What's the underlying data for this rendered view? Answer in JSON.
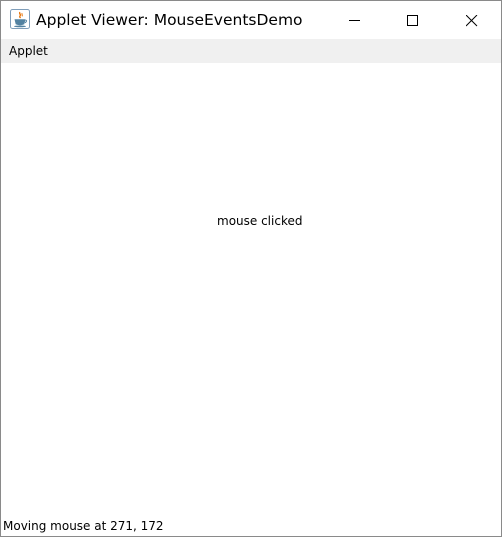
{
  "window": {
    "title": "Applet Viewer: MouseEventsDemo"
  },
  "title_controls": {
    "minimize_icon": "minimize-icon",
    "maximize_icon": "maximize-icon",
    "close_icon": "close-icon"
  },
  "menubar": {
    "items": [
      {
        "label": "Applet"
      }
    ]
  },
  "applet": {
    "message": "mouse clicked"
  },
  "status": {
    "text": "Moving mouse at 271, 172"
  },
  "colors": {
    "menubar_bg": "#f0f0f0",
    "java_cup_blue": "#5382a1",
    "java_flame_orange": "#e76f00"
  }
}
